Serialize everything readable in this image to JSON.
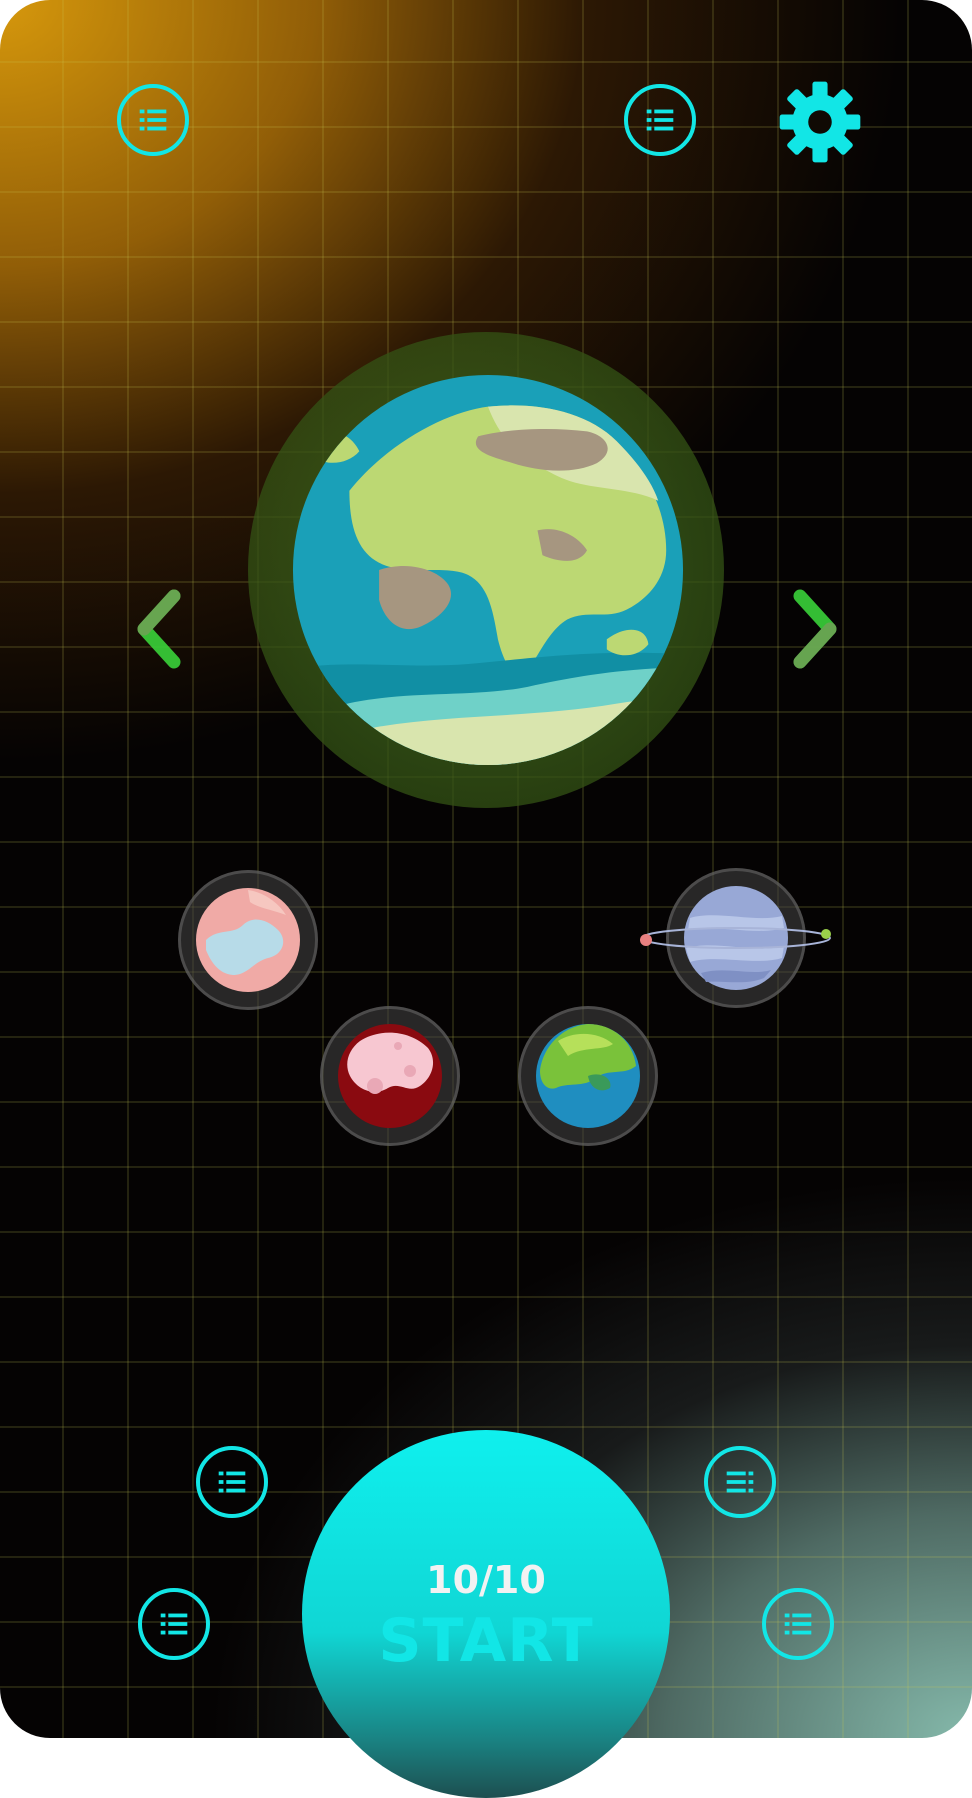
{
  "top_bar": {
    "menu_left_icon": "list-icon",
    "menu_right_icon": "list-icon",
    "settings_icon": "gear-icon"
  },
  "planet_carousel": {
    "selected_planet": "earth",
    "prev_icon": "chevron-left-icon",
    "next_icon": "chevron-right-icon"
  },
  "planet_options": [
    "pink-blue-planet",
    "ringed-blue-planet",
    "red-crater-planet",
    "green-blue-planet"
  ],
  "bottom_menu": {
    "icons": [
      "list-icon",
      "list-icon",
      "list-icon",
      "list-icon"
    ]
  },
  "start_button": {
    "count": "10/10",
    "label": "START"
  },
  "colors": {
    "accent": "#12e6e6",
    "arrow": "#3ad23a",
    "background_top": "#d6980c",
    "background_bottom": "#8cc3b4"
  }
}
